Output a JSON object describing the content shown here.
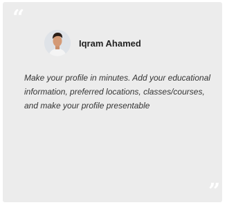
{
  "testimonial": {
    "author_name": "Iqram Ahamed",
    "avatar_icon": "user-photo-avatar",
    "quote_open_icon": "quote-open-icon",
    "quote_close_icon": "quote-close-icon",
    "text": "Make your profile in minutes. Add your educational information, preferred locations, classes/courses, and make your profile presentable"
  },
  "colors": {
    "card_background": "#ececec",
    "quote_mark": "#ffffff",
    "text": "#333333",
    "name": "#222222"
  }
}
